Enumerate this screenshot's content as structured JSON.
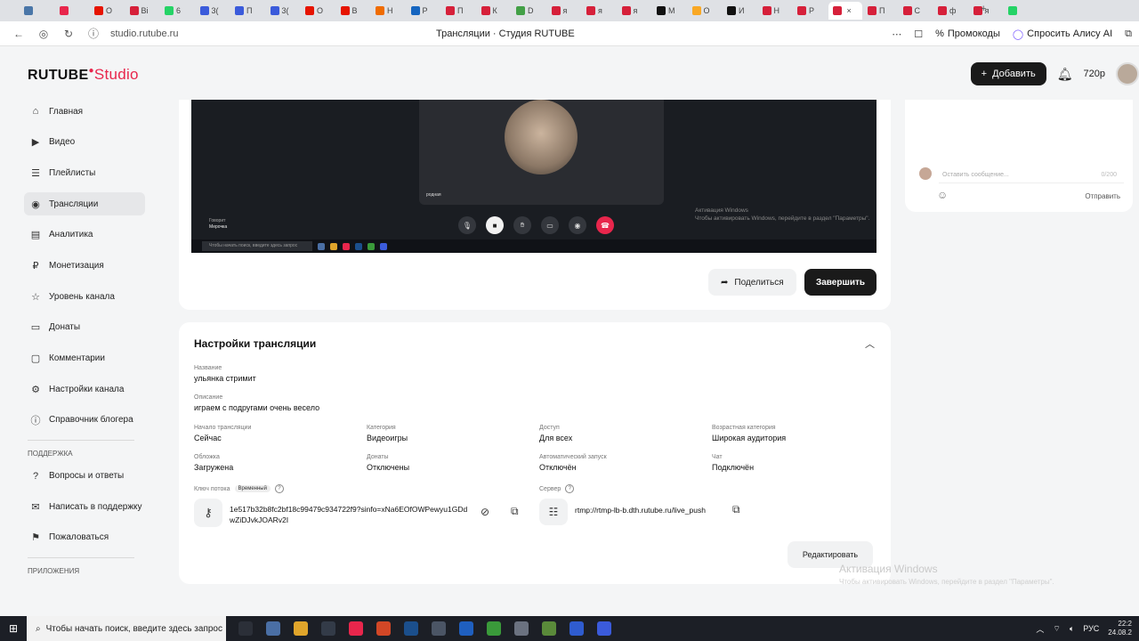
{
  "browser": {
    "tabs": [
      {
        "icon": "vk-icon",
        "label": "",
        "color": "#4a76a8"
      },
      {
        "icon": "mail-icon",
        "label": "",
        "color": "#e8264c"
      },
      {
        "icon": "yandex-icon",
        "label": "О",
        "color": "#e61400"
      },
      {
        "icon": "red-icon",
        "label": "Ві",
        "color": "#d6203a"
      },
      {
        "icon": "whatsapp-icon",
        "label": "6",
        "color": "#25d366"
      },
      {
        "icon": "tab-icon",
        "label": "3(",
        "color": "#3b5bdb"
      },
      {
        "icon": "tab-icon",
        "label": "П",
        "color": "#3b5bdb"
      },
      {
        "icon": "tab-icon",
        "label": "3(",
        "color": "#3b5bdb"
      },
      {
        "icon": "tab-icon",
        "label": "О",
        "color": "#e61400"
      },
      {
        "icon": "tab-icon",
        "label": "В",
        "color": "#e61400"
      },
      {
        "icon": "tab-icon",
        "label": "Н",
        "color": "#ef6c00"
      },
      {
        "icon": "tab-icon",
        "label": "Р",
        "color": "#1565c0"
      },
      {
        "icon": "tab-icon",
        "label": "П",
        "color": "#d6203a"
      },
      {
        "icon": "tab-icon",
        "label": "К",
        "color": "#d6203a"
      },
      {
        "icon": "tab-icon",
        "label": "D",
        "color": "#43a047"
      },
      {
        "icon": "tab-icon",
        "label": "я",
        "color": "#d6203a"
      },
      {
        "icon": "tab-icon",
        "label": "я",
        "color": "#d6203a"
      },
      {
        "icon": "tab-icon",
        "label": "я",
        "color": "#d6203a"
      },
      {
        "icon": "tab-icon",
        "label": "М",
        "color": "#111"
      },
      {
        "icon": "tab-icon",
        "label": "О",
        "color": "#f9a825"
      },
      {
        "icon": "tab-icon",
        "label": "И",
        "color": "#111"
      },
      {
        "icon": "tab-icon",
        "label": "Н",
        "color": "#d6203a"
      },
      {
        "icon": "tab-icon",
        "label": "Р",
        "color": "#d6203a"
      },
      {
        "icon": "tab-icon",
        "label": "",
        "color": "#d6203a",
        "active": true
      },
      {
        "icon": "tab-icon",
        "label": "П",
        "color": "#d6203a"
      },
      {
        "icon": "tab-icon",
        "label": "С",
        "color": "#d6203a"
      },
      {
        "icon": "tab-icon",
        "label": "ф",
        "color": "#d6203a"
      },
      {
        "icon": "tab-icon",
        "label": "я",
        "color": "#d6203a"
      },
      {
        "icon": "tab-icon",
        "label": "",
        "color": "#25d366"
      }
    ],
    "new_tab": "+",
    "url": "studio.rutube.ru",
    "page_title": "Трансляции · Студия RUTUBE",
    "promo_label": "Промокоды",
    "alice_label": "Спросить Алису AI"
  },
  "header": {
    "logo_main": "RUTUBE",
    "logo_accent": "Studio",
    "add_button": "Добавить",
    "resolution": "720p"
  },
  "sidebar": {
    "items": [
      {
        "label": "Главная",
        "icon": "home-icon",
        "glyph": "⌂"
      },
      {
        "label": "Видео",
        "icon": "video-icon",
        "glyph": "▶"
      },
      {
        "label": "Плейлисты",
        "icon": "playlist-icon",
        "glyph": "☰"
      },
      {
        "label": "Трансляции",
        "icon": "broadcast-icon",
        "glyph": "◉",
        "active": true
      },
      {
        "label": "Аналитика",
        "icon": "analytics-icon",
        "glyph": "▤"
      },
      {
        "label": "Монетизация",
        "icon": "monetization-icon",
        "glyph": "₽"
      },
      {
        "label": "Уровень канала",
        "icon": "star-icon",
        "glyph": "☆"
      },
      {
        "label": "Донаты",
        "icon": "donate-icon",
        "glyph": "▭"
      },
      {
        "label": "Комментарии",
        "icon": "comments-icon",
        "glyph": "▢"
      },
      {
        "label": "Настройки канала",
        "icon": "gear-icon",
        "glyph": "⚙"
      },
      {
        "label": "Справочник блогера",
        "icon": "info-icon",
        "glyph": "ⓘ"
      }
    ],
    "support_label": "ПОДДЕРЖКА",
    "support_items": [
      {
        "label": "Вопросы и ответы",
        "icon": "question-icon",
        "glyph": "?"
      },
      {
        "label": "Написать в поддержку",
        "icon": "mail-icon",
        "glyph": "✉"
      },
      {
        "label": "Пожаловаться",
        "icon": "flag-icon",
        "glyph": "⚑"
      }
    ],
    "apps_label": "ПРИЛОЖЕНИЯ"
  },
  "stream": {
    "video_overlay_name": "родная",
    "video_speaker_label": "Говорит",
    "video_speaker_name": "Мерочка",
    "video_search_text": "Чтобы начать поиск, введите здесь запрос",
    "video_watermark_title": "Активация Windows",
    "video_watermark_text": "Чтобы активировать Windows, перейдите в раздел \"Параметры\".",
    "share_button": "Поделиться",
    "finish_button": "Завершить"
  },
  "chat": {
    "placeholder": "Оставить сообщение...",
    "counter": "0/200",
    "send_button": "Отправить"
  },
  "settings": {
    "title": "Настройки трансляции",
    "name_label": "Название",
    "name_value": "ульянка стримит",
    "desc_label": "Описание",
    "desc_value": "играем с подругами очень весело",
    "fields_row1": [
      {
        "label": "Начало трансляции",
        "value": "Сейчас"
      },
      {
        "label": "Категория",
        "value": "Видеоигры"
      },
      {
        "label": "Доступ",
        "value": "Для всех"
      },
      {
        "label": "Возрастная категория",
        "value": "Широкая аудитория"
      }
    ],
    "fields_row2": [
      {
        "label": "Обложка",
        "value": "Загружена"
      },
      {
        "label": "Донаты",
        "value": "Отключены"
      },
      {
        "label": "Автоматический запуск",
        "value": "Отключён"
      },
      {
        "label": "Чат",
        "value": "Подключён"
      }
    ],
    "key_label": "Ключ потока",
    "key_badge": "Временный",
    "key_value": "1e517b32b8fc2bf18c99479c934722f9?sinfo=xNa6EOfOWPewyu1GDdwZiDJvkJOARv2I",
    "server_label": "Сервер",
    "server_value": "rtmp://rtmp-lb-b.dth.rutube.ru/live_push",
    "edit_button": "Редактировать"
  },
  "watermark": {
    "title": "Активация Windows",
    "text": "Чтобы активировать Windows, перейдите в раздел \"Параметры\"."
  },
  "taskbar": {
    "search_text": "Чтобы начать поиск, введите здесь запрос",
    "apps": [
      {
        "icon": "task-view-icon",
        "color": "#2b2f38"
      },
      {
        "icon": "file-manager-icon",
        "color": "#4a6fa5"
      },
      {
        "icon": "chrome-icon",
        "color": "#e0a52b"
      },
      {
        "icon": "obs-icon",
        "color": "#333b48"
      },
      {
        "icon": "yandex-browser-icon",
        "color": "#e8264c"
      },
      {
        "icon": "powerpoint-icon",
        "color": "#d24726"
      },
      {
        "icon": "steam-icon",
        "color": "#1b4f8c"
      },
      {
        "icon": "app-icon",
        "color": "#4b5565"
      },
      {
        "icon": "app-icon",
        "color": "#1f5fbf"
      },
      {
        "icon": "minecraft-icon",
        "color": "#3a9a3a"
      },
      {
        "icon": "app-icon",
        "color": "#6b7280"
      },
      {
        "icon": "app-icon",
        "color": "#5a8a3a"
      },
      {
        "icon": "ea-icon",
        "color": "#2f5ccf"
      },
      {
        "icon": "discord-icon",
        "color": "#3b5bdb"
      }
    ],
    "lang": "РУС",
    "time": "22:2",
    "date": "24.08.2"
  }
}
